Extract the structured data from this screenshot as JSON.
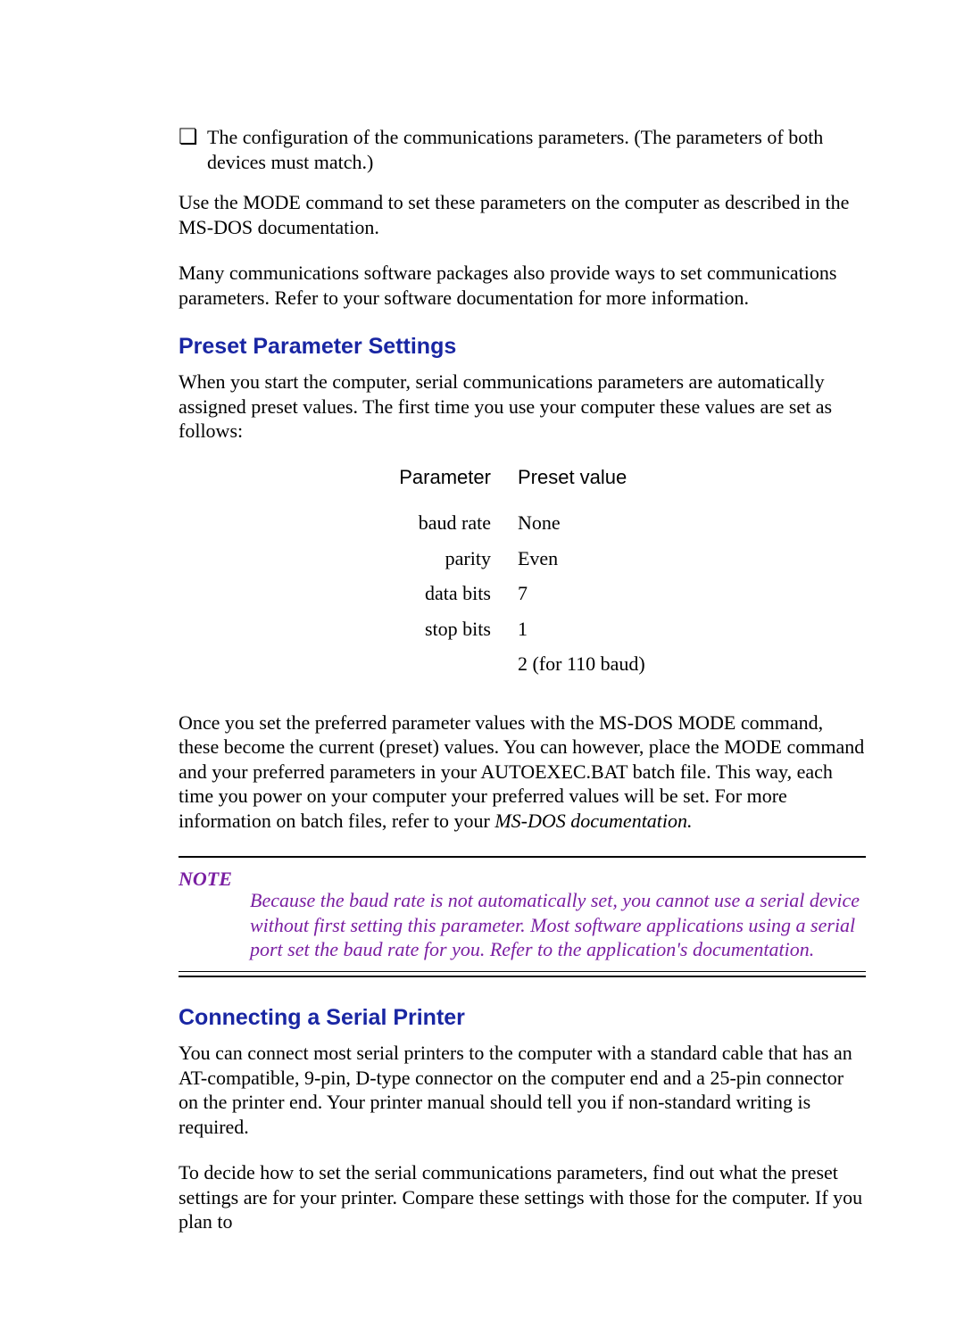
{
  "bullet": {
    "glyph": "❏",
    "text": "The configuration of the communications parameters. (The parameters of both devices must match.)"
  },
  "intro": {
    "p1": "Use the MODE command to set these parameters on the computer as described in the MS-DOS documentation.",
    "p2": "Many communications software packages also provide ways to set communications parameters. Refer to your software documentation for more information."
  },
  "section1": {
    "heading": "Preset Parameter Settings",
    "lead": "When you start the computer, serial communications parameters are automatically assigned preset values. The first time you use your computer these values are set as follows:",
    "table": {
      "header_left": "Parameter",
      "header_right": "Preset value",
      "rows": [
        {
          "param": "baud rate",
          "value": "None"
        },
        {
          "param": "parity",
          "value": "Even"
        },
        {
          "param": "data bits",
          "value": "7"
        },
        {
          "param": "stop bits",
          "value": "1"
        },
        {
          "param": "",
          "value": "2 (for 110 baud)"
        }
      ]
    },
    "after_a": "Once you set the preferred parameter values with the MS-DOS MODE command, these become the current (preset) values. You can however, place the MODE command and your preferred parameters in your AUTOEXEC.BAT batch file. This way, each time you power on your computer your preferred values will be set. For more information on batch files, refer to your ",
    "after_em": "MS-DOS documentation."
  },
  "note": {
    "label": "NOTE",
    "body": "Because the baud rate is not automatically set, you cannot use a serial device without first setting this parameter. Most software applications using a serial port set the baud rate for you. Refer to the application's documentation."
  },
  "section2": {
    "heading": "Connecting a Serial Printer",
    "p1": "You can connect most serial printers to the computer with a standard cable that has an AT-compatible, 9-pin, D-type connector on the computer end and a 25-pin connector on the printer end. Your printer manual should tell you if non-standard writing is required.",
    "p2": "To decide how to set the serial communications parameters, find out what the preset settings are for your printer. Compare these settings with those for the computer. If you plan to"
  }
}
